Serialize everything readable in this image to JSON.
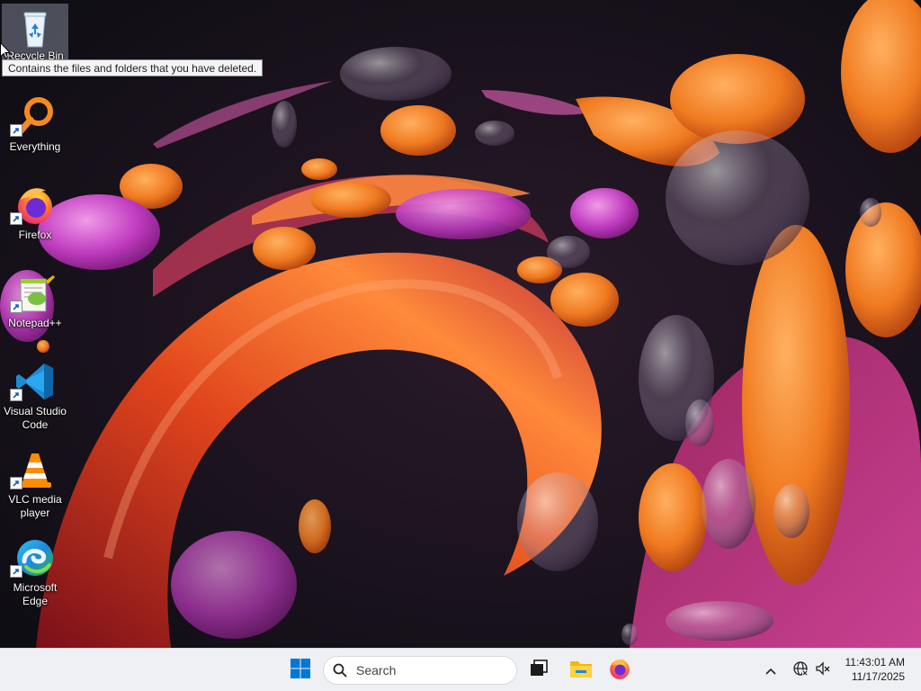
{
  "desktop": {
    "icons": [
      {
        "label": "Recycle Bin",
        "icon": "recycle-bin-icon"
      },
      {
        "label": "Everything",
        "icon": "everything-search-icon"
      },
      {
        "label": "Firefox",
        "icon": "firefox-icon"
      },
      {
        "label": "Notepad++",
        "icon": "notepad-plus-plus-icon"
      },
      {
        "label": "Visual Studio Code",
        "icon": "vscode-icon"
      },
      {
        "label": "VLC media player",
        "icon": "vlc-icon"
      },
      {
        "label": "Microsoft Edge",
        "icon": "edge-icon"
      }
    ],
    "tooltip": "Contains the files and folders that you have deleted."
  },
  "taskbar": {
    "search_placeholder": "Search",
    "pinned": [
      {
        "icon": "windows-start-icon"
      },
      {
        "icon": "task-view-icon"
      },
      {
        "icon": "file-explorer-icon"
      },
      {
        "icon": "firefox-icon"
      }
    ],
    "tray": [
      {
        "icon": "chevron-up-icon"
      },
      {
        "icon": "network-globe-icon"
      },
      {
        "icon": "speaker-muted-icon"
      }
    ],
    "clock": {
      "time": "11:43:01 AM",
      "date": "11/17/2025"
    }
  },
  "colors": {
    "accent": "#0067c0",
    "taskbar_bg": "#eef0f3",
    "wallpaper_bg": "#14111a"
  }
}
